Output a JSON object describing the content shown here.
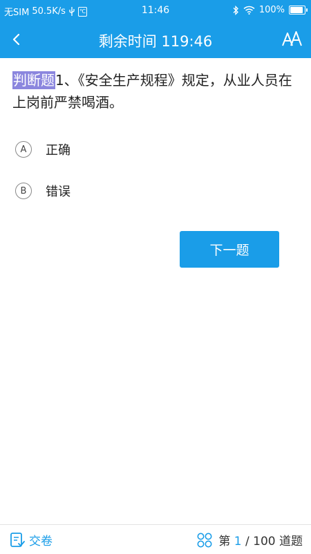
{
  "status_bar": {
    "carrier": "无SIM",
    "network_speed": "50.5K/s",
    "time": "11:46",
    "battery_text": "100%",
    "battery_level": 1.0
  },
  "title_bar": {
    "title": "剩余时间 119:46"
  },
  "question": {
    "type_label": "判断题",
    "text": "1、《安全生产规程》规定，从业人员在上岗前严禁喝酒。"
  },
  "options": [
    {
      "letter": "A",
      "text": "正确"
    },
    {
      "letter": "B",
      "text": "错误"
    }
  ],
  "next_button": "下一题",
  "bottom_bar": {
    "submit_label": "交卷",
    "progress_prefix": "第 ",
    "progress_current": "1",
    "progress_suffix": " / 100 道题"
  },
  "colors": {
    "accent": "#1a9de8",
    "question_type_highlight": "#8b86de"
  },
  "icons": {
    "back": "chevron-left-icon",
    "font_size": "font-size-icon",
    "submit": "submit-paper-icon",
    "grid": "question-grid-icon",
    "usb": "usb-icon",
    "bluetooth": "bluetooth-icon",
    "wifi": "wifi-icon"
  }
}
